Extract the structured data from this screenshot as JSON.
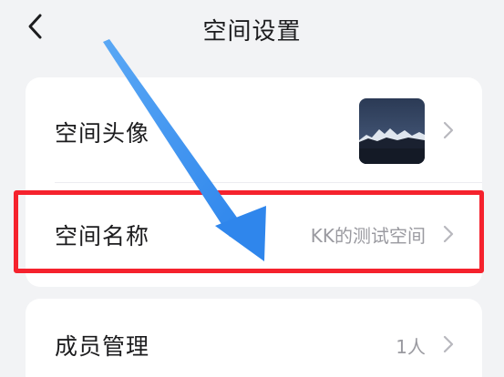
{
  "header": {
    "title": "空间设置",
    "back_icon": "chevron-left-icon"
  },
  "settings": {
    "avatar_row": {
      "label": "空间头像"
    },
    "name_row": {
      "label": "空间名称",
      "value": "KK的测试空间"
    },
    "members_row": {
      "label": "成员管理",
      "value": "1人"
    }
  },
  "annotation": {
    "highlight_color": "#f5222d",
    "arrow_color": "#3a8ff0"
  },
  "colors": {
    "background": "#f2f3f5",
    "card": "#ffffff",
    "muted_text": "#9a9aa0"
  }
}
